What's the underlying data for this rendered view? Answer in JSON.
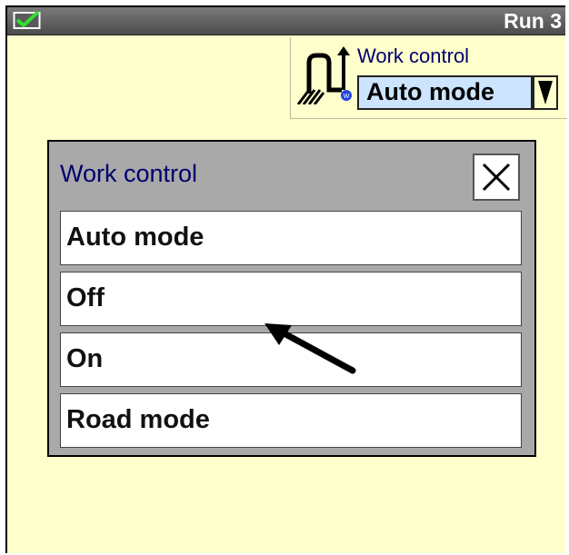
{
  "topbar": {
    "run_label": "Run 3",
    "status_icon": "check-icon"
  },
  "work_control_panel": {
    "title": "Work control",
    "selected_value": "Auto mode",
    "icon": "work-control-icon",
    "dropdown_icon": "triangle-down-icon"
  },
  "dialog": {
    "title": "Work control",
    "close_icon": "close-icon",
    "options": [
      {
        "label": "Auto mode"
      },
      {
        "label": "Off"
      },
      {
        "label": "On"
      },
      {
        "label": "Road mode"
      }
    ]
  },
  "colors": {
    "background": "#ffffcc",
    "topbar": "#5e5e5e",
    "title_text": "#00006e",
    "selected_bg": "#cde4ff",
    "dialog_bg": "#a9a9a9"
  }
}
